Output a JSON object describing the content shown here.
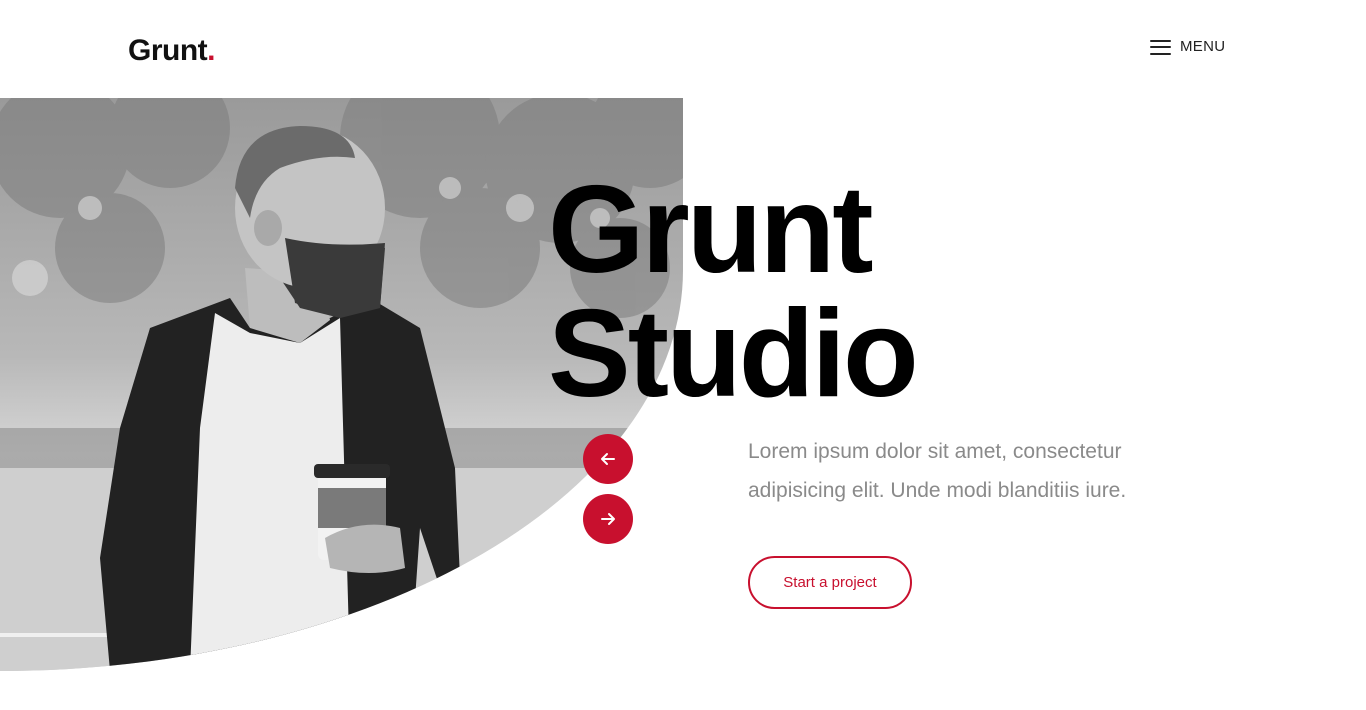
{
  "header": {
    "logo_text": "Grunt",
    "logo_dot": ".",
    "menu_label": "MENU",
    "menu_icon": "hamburger-icon"
  },
  "hero": {
    "title_line1": "Grunt",
    "title_line2": "Studio",
    "lead": "Lorem ipsum dolor sit amet, consectetur adipisicing elit. Unde modi blanditiis iure.",
    "cta_label": "Start a project",
    "prev_icon": "arrow-left-icon",
    "next_icon": "arrow-right-icon",
    "photo": "grayscale photo of bearded man holding coffee cup"
  },
  "colors": {
    "accent": "#c8102e",
    "text": "#000000",
    "muted": "#8a8a8a",
    "background": "#ffffff"
  }
}
